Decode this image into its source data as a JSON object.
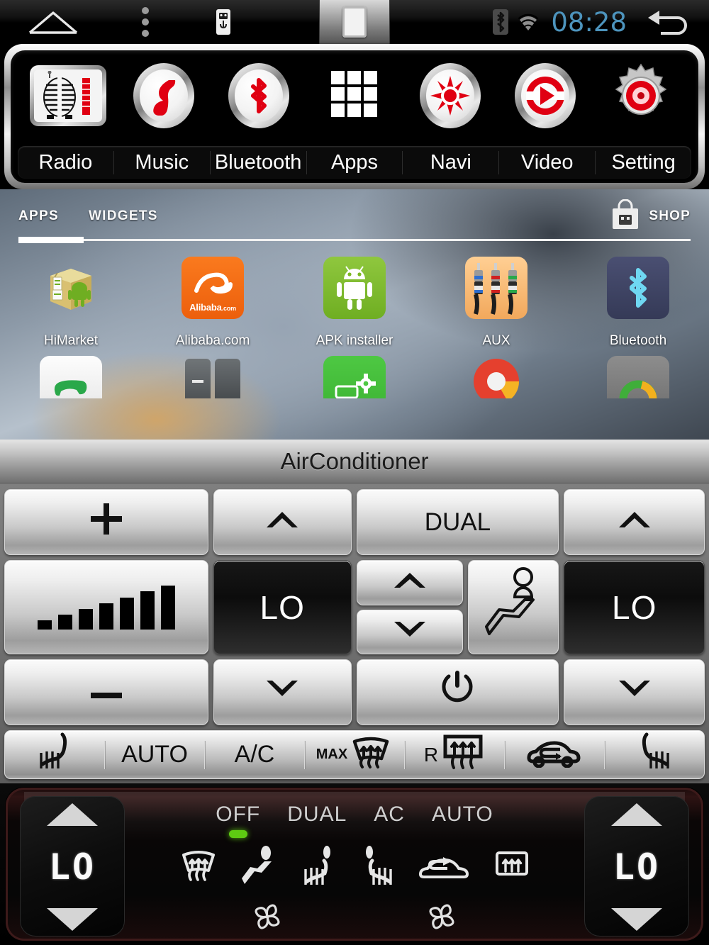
{
  "statusbar": {
    "home_icon": "home-icon",
    "menu_icon": "overflow-menu-icon",
    "usb_icon": "usb-icon",
    "recents_icon": "recents-square-icon",
    "bluetooth_icon": "bluetooth-icon",
    "wifi_icon": "wifi-icon",
    "clock": "08:28",
    "back_icon": "back-arrow-icon",
    "clock_color": "#4d94bd"
  },
  "source_nav": {
    "items": [
      {
        "label": "Radio",
        "icon": "radio-icon"
      },
      {
        "label": "Music",
        "icon": "music-note-icon"
      },
      {
        "label": "Bluetooth",
        "icon": "bluetooth-icon"
      },
      {
        "label": "Apps",
        "icon": "apps-grid-icon"
      },
      {
        "label": "Navi",
        "icon": "compass-icon"
      },
      {
        "label": "Video",
        "icon": "play-circle-icon"
      },
      {
        "label": "Setting",
        "icon": "gear-icon"
      }
    ],
    "accent_color": "#e00012"
  },
  "drawer": {
    "tabs": [
      {
        "label": "APPS",
        "active": true
      },
      {
        "label": "WIDGETS",
        "active": false
      }
    ],
    "shop": {
      "label": "SHOP",
      "icon": "shopping-bag-icon"
    },
    "apps_row1": [
      {
        "label": "HiMarket",
        "icon": "himarket-box-icon",
        "color": "#d9c171"
      },
      {
        "label": "Alibaba.com",
        "icon": "alibaba-icon",
        "color": "#f4740e"
      },
      {
        "label": "APK installer",
        "icon": "android-robot-icon",
        "color": "#7cb924"
      },
      {
        "label": "AUX",
        "icon": "rca-plugs-icon",
        "color": "#f7bc7b"
      },
      {
        "label": "Bluetooth",
        "icon": "bluetooth-icon",
        "color": "#3f4463"
      }
    ],
    "apps_row2": [
      {
        "label": "",
        "icon": "phone-icon",
        "color": "#f2f2f2"
      },
      {
        "label": "",
        "icon": "calculator-icon",
        "color": "#5b5f63"
      },
      {
        "label": "",
        "icon": "car-settings-icon",
        "color": "#49c23f"
      },
      {
        "label": "",
        "icon": "browser-icon",
        "color": "#e5402e"
      },
      {
        "label": "",
        "icon": "gallery-icon",
        "color": "#7a7a7a"
      }
    ]
  },
  "airconditioner": {
    "title": "AirConditioner",
    "row1": [
      {
        "name": "volume-up-button",
        "label": "+",
        "icon": "plus-icon",
        "style": "light"
      },
      {
        "name": "left-temp-up-button",
        "label": "",
        "icon": "chevron-up-icon",
        "style": "light"
      },
      {
        "name": "dual-button",
        "label": "DUAL",
        "icon": "",
        "style": "light"
      },
      {
        "name": "right-temp-up-button",
        "label": "",
        "icon": "chevron-up-icon",
        "style": "light"
      }
    ],
    "row2": {
      "fan_speed": {
        "name": "fan-speed-button",
        "icon": "fan-speed-bars-icon",
        "bars": 7
      },
      "left_temp_display": {
        "name": "left-temp-display",
        "value": "LO"
      },
      "blower_up": {
        "name": "blower-up-button",
        "icon": "chevron-up-icon"
      },
      "blower_down": {
        "name": "blower-down-button",
        "icon": "chevron-down-icon"
      },
      "mode": {
        "name": "airflow-mode-button",
        "icon": "airflow-body-icon"
      },
      "right_temp_display": {
        "name": "right-temp-display",
        "value": "LO"
      }
    },
    "row3": [
      {
        "name": "volume-down-button",
        "label": "-",
        "icon": "minus-icon",
        "style": "light"
      },
      {
        "name": "left-temp-down-button",
        "label": "",
        "icon": "chevron-down-icon",
        "style": "light"
      },
      {
        "name": "power-button",
        "label": "",
        "icon": "power-icon",
        "style": "light"
      },
      {
        "name": "right-temp-down-button",
        "label": "",
        "icon": "chevron-down-icon",
        "style": "light"
      }
    ],
    "toolbar": [
      {
        "name": "seat-heat-left-button",
        "label": "",
        "icon": "seat-heater-left-icon"
      },
      {
        "name": "auto-button",
        "label": "AUTO",
        "icon": ""
      },
      {
        "name": "ac-button",
        "label": "A/C",
        "icon": ""
      },
      {
        "name": "max-defrost-button",
        "label": "MAX",
        "icon": "front-defrost-icon"
      },
      {
        "name": "rear-defrost-button",
        "label": "R",
        "icon": "rear-defrost-icon"
      },
      {
        "name": "recirculation-button",
        "label": "",
        "icon": "recirculation-car-icon"
      },
      {
        "name": "seat-heat-right-button",
        "label": "",
        "icon": "seat-heater-right-icon"
      }
    ]
  },
  "hardware_panel": {
    "left_display": {
      "value": "LO",
      "up_icon": "triangle-up-icon",
      "down_icon": "triangle-down-icon"
    },
    "right_display": {
      "value": "LO",
      "up_icon": "triangle-up-icon",
      "down_icon": "triangle-down-icon"
    },
    "modes": [
      {
        "label": "OFF",
        "active": true,
        "led_color": "#5ecb12"
      },
      {
        "label": "DUAL",
        "active": false,
        "led_color": ""
      },
      {
        "label": "AC",
        "active": false,
        "led_color": ""
      },
      {
        "label": "AUTO",
        "active": false,
        "led_color": ""
      }
    ],
    "icons": [
      {
        "name": "front-defrost-icon"
      },
      {
        "name": "airflow-body-icon"
      },
      {
        "name": "seat-heater-left-icon"
      },
      {
        "name": "seat-heater-right-icon"
      },
      {
        "name": "recirculation-car-icon"
      },
      {
        "name": "rear-defrost-icon"
      }
    ],
    "fan_icons": [
      {
        "name": "fan-left-icon"
      },
      {
        "name": "fan-right-icon"
      }
    ]
  }
}
